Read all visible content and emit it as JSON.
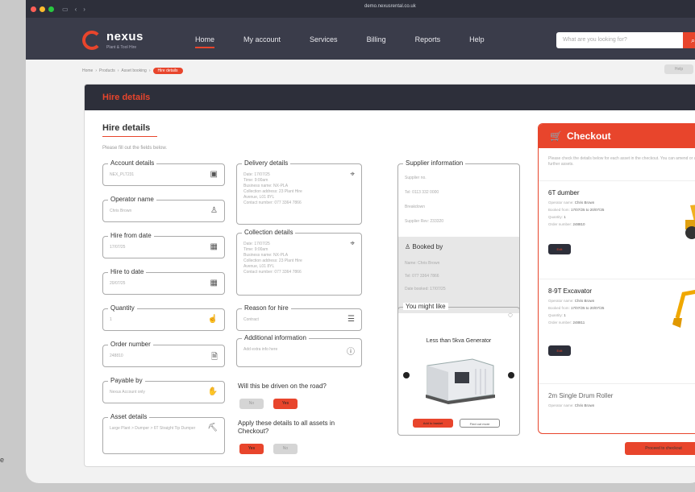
{
  "browser": {
    "url": "demo.nexusrental.co.uk"
  },
  "header": {
    "logo_name": "nexus",
    "logo_sub": "Plant & Tool Hire",
    "nav": [
      "Home",
      "My account",
      "Services",
      "Billing",
      "Reports",
      "Help"
    ],
    "active_nav": "Home",
    "search_placeholder": "What are you looking for?"
  },
  "breadcrumb": [
    "Home",
    "Products",
    "Asset booking",
    "Hire details"
  ],
  "help_label": "Help",
  "page": {
    "banner_title": "Hire details",
    "section_title": "Hire details",
    "section_sub": "Please fill out the fields below."
  },
  "fields_left": [
    {
      "label": "Account details",
      "value": "NEX_PLT231",
      "icon": "id-card-icon"
    },
    {
      "label": "Operator name",
      "value": "Chris Brown",
      "icon": "user-icon"
    },
    {
      "label": "Hire from date",
      "value": "17/07/25",
      "icon": "calendar-icon"
    },
    {
      "label": "Hire to date",
      "value": "20/07/25",
      "icon": "calendar-icon"
    },
    {
      "label": "Quantity",
      "value": "1",
      "icon": "hand-icon"
    },
    {
      "label": "Order number",
      "value": "248810",
      "icon": "document-search-icon"
    },
    {
      "label": "Payable by",
      "value": "Nexus Account only",
      "icon": "payment-hand-icon"
    },
    {
      "label": "Asset details",
      "value": "Large Plant > Dumper > 6T Straight Tip Dumper",
      "icon": "excavator-icon"
    }
  ],
  "delivery": {
    "label": "Delivery details",
    "lines": [
      "Date: 17/07/25",
      "Time: 9:00am",
      "Business name: NX-PLA",
      "Collection address: 23 Plant Hire",
      "Avenue, L01 8YL",
      "Contact number: 077 3364 7866"
    ]
  },
  "collection": {
    "label": "Collection details",
    "lines": [
      "Date: 17/07/25",
      "Time: 9:00am",
      "Business name: NX-PLA",
      "Collection address: 23 Plant Hire",
      "Avenue, L01 8YL",
      "Contact number: 077 3364 7866"
    ]
  },
  "reason": {
    "label": "Reason for hire",
    "value": "Contract"
  },
  "additional": {
    "label": "Additional information",
    "value": "Add extra info here"
  },
  "question_road": "Will this be driven on the road?",
  "question_apply": "Apply these details to all assets in Checkout?",
  "yes_label": "Yes",
  "no_label": "No",
  "supplier": {
    "label": "Supplier information",
    "lines": [
      "Supplier no.",
      "Tel: 0113 332 0000",
      "Breakdown",
      "Supplier Rev: 233320"
    ]
  },
  "booked_by": {
    "label": "Booked by",
    "lines": [
      "Name: Chris Brown",
      "Tel: 077 3364 7866",
      "Date booked: 17/07/25"
    ]
  },
  "might_like": {
    "label": "You might like",
    "product": "Less than 5kva Generator",
    "add_label": "Add to basket",
    "more_label": "Find out more"
  },
  "checkout": {
    "title": "Checkout",
    "sub": "Please check the details below for each asset in the checkout. You can amend or add further assets.",
    "items": [
      {
        "name": "6T dumber",
        "operator": "Chris Brown",
        "booked_from": "17/07/25 to 20/07/25",
        "quantity": "1",
        "order": "248810",
        "btn": "Edit"
      },
      {
        "name": "8-9T Excavator",
        "operator": "Chris Brown",
        "booked_from": "17/07/25 to 20/07/25",
        "quantity": "1",
        "order": "248811",
        "btn": "Edit"
      },
      {
        "name": "2m Single Drum Roller",
        "operator": "Chris Brown",
        "booked_from": "",
        "quantity": "",
        "order": "",
        "btn": ""
      }
    ],
    "line_labels": {
      "operator": "Operator name:",
      "booked": "Booked from:",
      "quantity": "Quantity:",
      "order": "Order number:"
    }
  },
  "proceed_label": "Proceed to checkout",
  "colors": {
    "accent": "#e8452c",
    "dark": "#2d2f3a"
  }
}
